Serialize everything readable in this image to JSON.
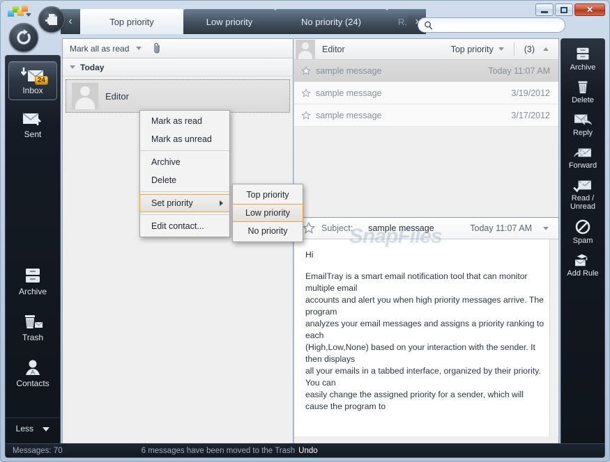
{
  "window": {
    "controls": {
      "minimize": "–",
      "maximize": "□",
      "close": "✕"
    }
  },
  "toolbar": {
    "logo_icon": "app-logo-icon",
    "compose_icon": "new-message-icon",
    "refresh_icon": "refresh-icon"
  },
  "tabs": [
    {
      "label": "Top priority",
      "active": true
    },
    {
      "label": "Low priority",
      "active": false
    },
    {
      "label": "No priority (24)",
      "active": false
    },
    {
      "label": "R...",
      "active": false
    }
  ],
  "tab_nav": {
    "prev": "‹",
    "next": "›"
  },
  "search": {
    "placeholder": "",
    "value": "",
    "icon": "search-icon"
  },
  "left_sidebar": {
    "items": [
      {
        "label": "Inbox",
        "icon": "inbox-icon",
        "badge": "24",
        "selected": true
      },
      {
        "label": "Sent",
        "icon": "sent-icon",
        "badge": "",
        "selected": false
      },
      {
        "label": "Archive",
        "icon": "archive-icon",
        "badge": "",
        "selected": false
      },
      {
        "label": "Trash",
        "icon": "trash-icon",
        "badge": "",
        "selected": false
      },
      {
        "label": "Contacts",
        "icon": "contacts-icon",
        "badge": "",
        "selected": false
      }
    ],
    "less_label": "Less"
  },
  "right_sidebar": {
    "items": [
      {
        "label": "Archive",
        "icon": "archive-icon"
      },
      {
        "label": "Delete",
        "icon": "trash-icon"
      },
      {
        "label": "Reply",
        "icon": "reply-icon"
      },
      {
        "label": "Forward",
        "icon": "forward-icon"
      },
      {
        "label": "Read / Unread",
        "icon": "read-unread-icon"
      },
      {
        "label": "Spam",
        "icon": "spam-icon"
      },
      {
        "label": "Add Rule",
        "icon": "add-rule-icon"
      }
    ]
  },
  "list_pane": {
    "mark_all_label": "Mark all as read",
    "attach_icon": "paperclip-icon",
    "group_header": "Today",
    "contacts": [
      {
        "name": "Editor",
        "avatar": "avatar"
      }
    ]
  },
  "message_pane": {
    "sender": "Editor",
    "priority_label": "Top priority",
    "count_label": "(3)",
    "messages": [
      {
        "subject": "sample message",
        "date": "Today 11:07 AM",
        "selected": true
      },
      {
        "subject": "sample message",
        "date": "3/19/2012",
        "selected": false
      },
      {
        "subject": "sample message",
        "date": "3/17/2012",
        "selected": false
      }
    ],
    "subject_label": "Subject:",
    "subject_value": "sample message",
    "subject_date": "Today 11:07 AM",
    "body_lines": [
      "Hi",
      "",
      "EmailTray is a smart email notification tool that can monitor multiple email",
      "accounts and alert you when high priority messages arrive. The program",
      "analyzes your email messages and assigns a priority ranking to each",
      "(High,Low,None) based on your interaction with the sender. It then displays",
      "all your emails in a tabbed interface, organized by their priority. You can",
      "easily change the assigned priority for a sender, which will cause the program to"
    ],
    "watermark": "SnapFiles"
  },
  "context_menu": {
    "items": [
      {
        "label": "Mark as read",
        "highlighted": false,
        "submenu": false
      },
      {
        "label": "Mark as unread",
        "highlighted": false,
        "submenu": false
      },
      {
        "label": "Archive",
        "highlighted": false,
        "submenu": false
      },
      {
        "label": "Delete",
        "highlighted": false,
        "submenu": false
      },
      {
        "label": "Set priority",
        "highlighted": true,
        "submenu": true
      },
      {
        "label": "Edit contact...",
        "highlighted": false,
        "submenu": false
      }
    ]
  },
  "submenu": {
    "items": [
      {
        "label": "Top priority",
        "highlighted": false
      },
      {
        "label": "Low priority",
        "highlighted": true
      },
      {
        "label": "No priority",
        "highlighted": false
      }
    ]
  },
  "status_bar": {
    "messages_count": "Messages: 70",
    "notice": "6 messages have been moved to the Trash",
    "undo_label": "Undo"
  },
  "colors": {
    "accent_orange": "#e8a33d",
    "badge_yellow": "#e8a922",
    "close_red": "#c9553c",
    "sidebar_dark": "#10151c"
  }
}
